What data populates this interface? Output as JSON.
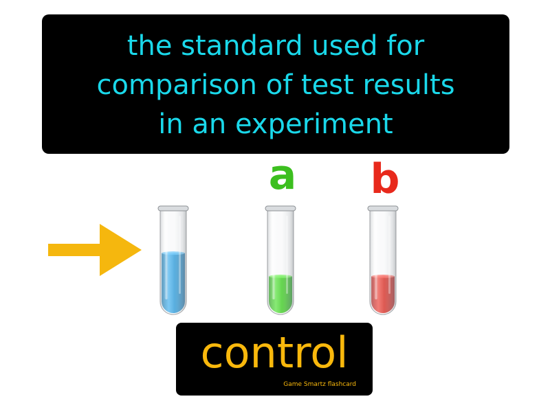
{
  "definition": {
    "lines": [
      "the standard used for",
      "comparison of test results",
      "in an experiment"
    ]
  },
  "tubes": [
    {
      "label": "",
      "liquid_color": "#2a94d0",
      "fill_level": 0.58
    },
    {
      "label": "a",
      "label_color": "#3cbf1f",
      "liquid_color": "#39c41d",
      "fill_level": 0.36
    },
    {
      "label": "b",
      "label_color": "#e8291c",
      "liquid_color": "#cf2a20",
      "fill_level": 0.36
    }
  ],
  "arrow_icon": "arrow-right-icon",
  "arrow_color": "#f5b70e",
  "term": {
    "word": "control",
    "brand": "Game Smartz flashcard"
  },
  "colors": {
    "definition_text": "#1ad8ea",
    "term_text": "#f9b80c",
    "box_background": "#000000"
  }
}
